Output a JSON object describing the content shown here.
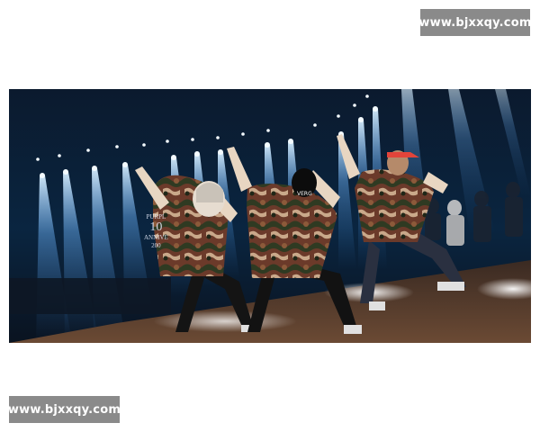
{
  "watermark": {
    "top_text": "www.bjxxqy.com",
    "bottom_text": "www.bjxxqy.com"
  },
  "photo": {
    "subject": "three-dancers-on-stage",
    "backdrop_lines": [
      "PURPL",
      "10",
      "ANNIVE",
      "200"
    ],
    "jacket_text": "VERG",
    "colors": {
      "stage_background": "#05101c",
      "spotlight": "#bfe4ff",
      "camo_jacket": "#6b3a2a",
      "visor": "#e2443a",
      "floor": "#5a3f2e"
    }
  }
}
